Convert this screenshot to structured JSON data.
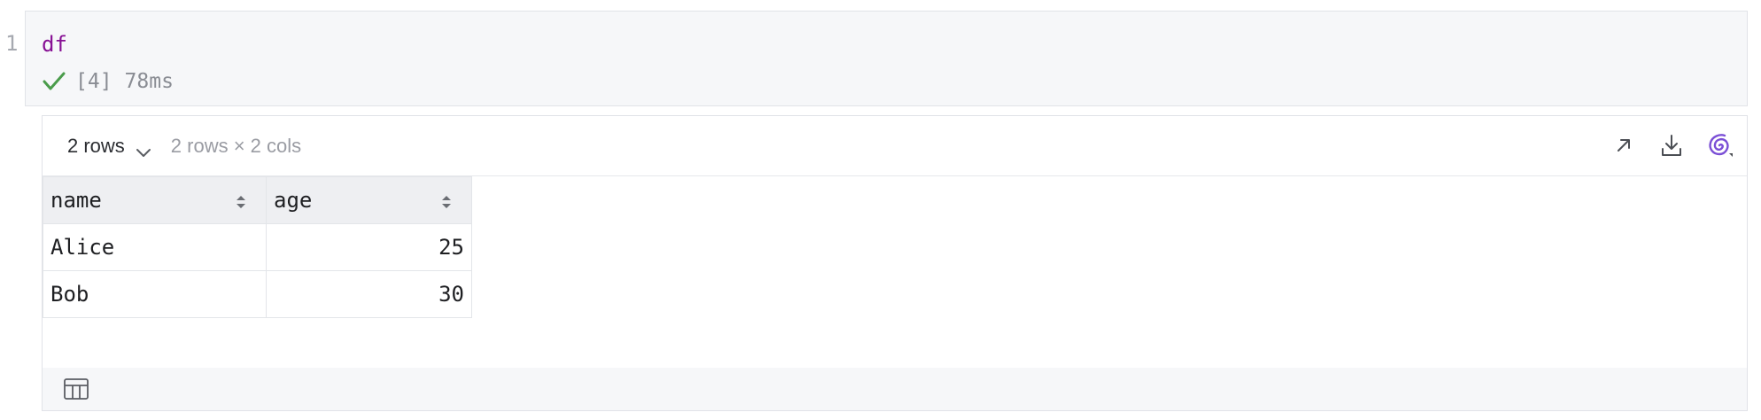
{
  "cell": {
    "line_number": "1",
    "code": "df",
    "exec_count": "[4]",
    "exec_time": "78ms"
  },
  "output": {
    "rows_selector": "2 rows",
    "shape": "2 rows × 2 cols",
    "columns": [
      {
        "label": "name"
      },
      {
        "label": "age"
      }
    ],
    "rows": [
      {
        "name": "Alice",
        "age": "25"
      },
      {
        "name": "Bob",
        "age": "30"
      }
    ]
  },
  "colors": {
    "code_keyword": "#871094",
    "success_check": "#4a9c4b",
    "accent_purple": "#7b4fd6"
  },
  "icons": {
    "status": "check-icon",
    "open_external": "arrow-up-right-icon",
    "download": "download-icon",
    "ai_assist": "spiral-icon",
    "table_view": "table-icon"
  }
}
